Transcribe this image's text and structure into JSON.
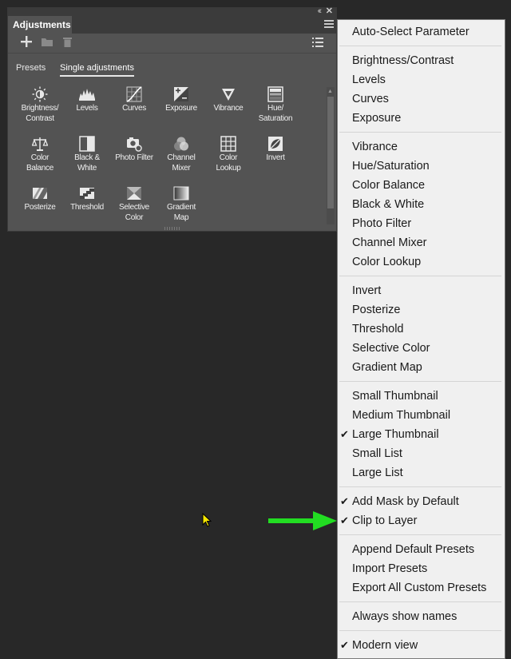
{
  "panel": {
    "title": "Adjustments",
    "tabs": [
      "Presets",
      "Single adjustments"
    ],
    "active_tab": "Single adjustments",
    "toolbar_icons": [
      "add-icon",
      "folder-icon",
      "trash-icon",
      "list-view-icon"
    ],
    "items": [
      {
        "label": "Brightness/ Contrast",
        "line1": "Brightness/",
        "line2": "Contrast",
        "icon": "brightness-icon"
      },
      {
        "label": "Levels",
        "line1": "Levels",
        "line2": "",
        "icon": "levels-icon"
      },
      {
        "label": "Curves",
        "line1": "Curves",
        "line2": "",
        "icon": "curves-icon"
      },
      {
        "label": "Exposure",
        "line1": "Exposure",
        "line2": "",
        "icon": "exposure-icon"
      },
      {
        "label": "Vibrance",
        "line1": "Vibrance",
        "line2": "",
        "icon": "vibrance-icon"
      },
      {
        "label": "Hue/ Saturation",
        "line1": "Hue/",
        "line2": "Saturation",
        "icon": "hue-saturation-icon"
      },
      {
        "label": "Color Balance",
        "line1": "Color",
        "line2": "Balance",
        "icon": "color-balance-icon"
      },
      {
        "label": "Black & White",
        "line1": "Black &",
        "line2": "White",
        "icon": "black-white-icon"
      },
      {
        "label": "Photo Filter",
        "line1": "Photo Filter",
        "line2": "",
        "icon": "photo-filter-icon"
      },
      {
        "label": "Channel Mixer",
        "line1": "Channel",
        "line2": "Mixer",
        "icon": "channel-mixer-icon"
      },
      {
        "label": "Color Lookup",
        "line1": "Color",
        "line2": "Lookup",
        "icon": "color-lookup-icon"
      },
      {
        "label": "Invert",
        "line1": "Invert",
        "line2": "",
        "icon": "invert-icon"
      },
      {
        "label": "Posterize",
        "line1": "Posterize",
        "line2": "",
        "icon": "posterize-icon"
      },
      {
        "label": "Threshold",
        "line1": "Threshold",
        "line2": "",
        "icon": "threshold-icon"
      },
      {
        "label": "Selective Color",
        "line1": "Selective",
        "line2": "Color",
        "icon": "selective-color-icon"
      },
      {
        "label": "Gradient Map",
        "line1": "Gradient",
        "line2": "Map",
        "icon": "gradient-map-icon"
      }
    ]
  },
  "menu": {
    "groups": [
      [
        {
          "label": "Auto-Select Parameter",
          "checked": false
        }
      ],
      [
        {
          "label": "Brightness/Contrast",
          "checked": false
        },
        {
          "label": "Levels",
          "checked": false
        },
        {
          "label": "Curves",
          "checked": false
        },
        {
          "label": "Exposure",
          "checked": false
        }
      ],
      [
        {
          "label": "Vibrance",
          "checked": false
        },
        {
          "label": "Hue/Saturation",
          "checked": false
        },
        {
          "label": "Color Balance",
          "checked": false
        },
        {
          "label": "Black & White",
          "checked": false
        },
        {
          "label": "Photo Filter",
          "checked": false
        },
        {
          "label": "Channel Mixer",
          "checked": false
        },
        {
          "label": "Color Lookup",
          "checked": false
        }
      ],
      [
        {
          "label": "Invert",
          "checked": false
        },
        {
          "label": "Posterize",
          "checked": false
        },
        {
          "label": "Threshold",
          "checked": false
        },
        {
          "label": "Selective Color",
          "checked": false
        },
        {
          "label": "Gradient Map",
          "checked": false
        }
      ],
      [
        {
          "label": "Small Thumbnail",
          "checked": false
        },
        {
          "label": "Medium Thumbnail",
          "checked": false
        },
        {
          "label": "Large Thumbnail",
          "checked": true
        },
        {
          "label": "Small List",
          "checked": false
        },
        {
          "label": "Large List",
          "checked": false
        }
      ],
      [
        {
          "label": "Add Mask by Default",
          "checked": true
        },
        {
          "label": "Clip to Layer",
          "checked": true
        }
      ],
      [
        {
          "label": "Append Default Presets",
          "checked": false
        },
        {
          "label": "Import Presets",
          "checked": false
        },
        {
          "label": "Export All Custom Presets",
          "checked": false
        }
      ],
      [
        {
          "label": "Always show names",
          "checked": false
        }
      ],
      [
        {
          "label": "Modern view",
          "checked": true
        }
      ]
    ]
  },
  "annotation": {
    "arrow_color": "#22dd22",
    "points_to": "Clip to Layer"
  },
  "colors": {
    "panel_bg": "#535353",
    "app_bg": "#282828",
    "menu_bg": "#f0f0f0"
  }
}
